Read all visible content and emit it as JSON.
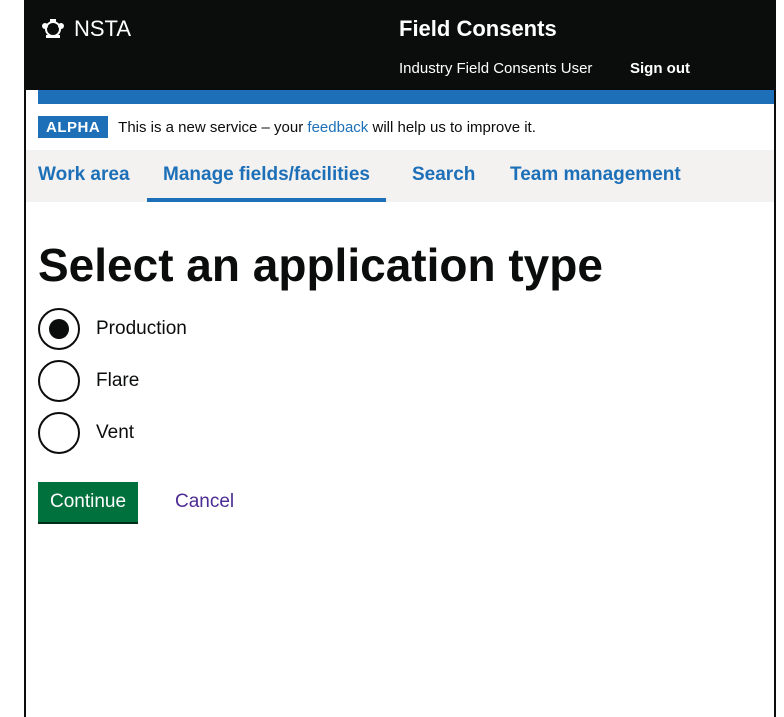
{
  "header": {
    "logo_text": "NSTA",
    "service_name": "Field Consents",
    "user_name": "Industry Field Consents User",
    "sign_out": "Sign out"
  },
  "phase_banner": {
    "tag": "ALPHA",
    "text_before": "This is a new service – your ",
    "link": "feedback",
    "text_after": " will help us to improve it."
  },
  "nav": {
    "items": [
      {
        "label": "Work area",
        "active": false
      },
      {
        "label": "Manage fields/facilities",
        "active": true
      },
      {
        "label": "Search",
        "active": false
      },
      {
        "label": "Team management",
        "active": false
      }
    ]
  },
  "form": {
    "heading": "Select an application type",
    "options": [
      {
        "label": "Production",
        "checked": true
      },
      {
        "label": "Flare",
        "checked": false
      },
      {
        "label": "Vent",
        "checked": false
      }
    ],
    "continue_label": "Continue",
    "cancel_label": "Cancel"
  },
  "colors": {
    "header_bg": "#0b0c0c",
    "brand_blue": "#1d70b8",
    "button_green": "#00703c",
    "nav_bg": "#f3f2f1"
  }
}
